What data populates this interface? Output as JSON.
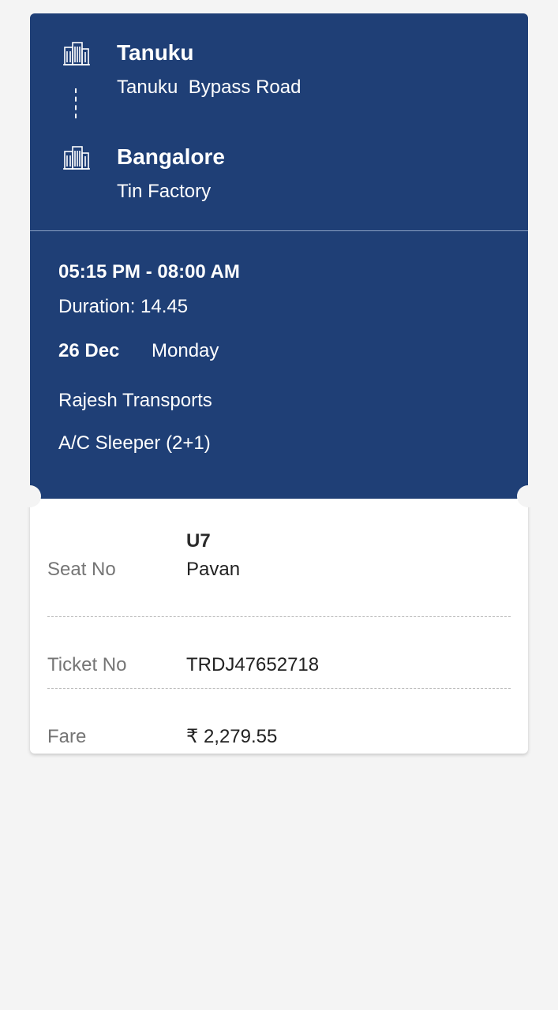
{
  "route": {
    "origin": {
      "city": "Tanuku",
      "point": "Tanuku  Bypass Road",
      "icon": "building-icon"
    },
    "destination": {
      "city": "Bangalore",
      "point": "Tin Factory",
      "icon": "building-icon"
    }
  },
  "journey": {
    "time_range": "05:15 PM - 08:00 AM",
    "duration": "Duration: 14.45",
    "date": "26 Dec",
    "day": "Monday",
    "operator": "Rajesh Transports",
    "bus_type": "A/C Sleeper (2+1)"
  },
  "details": {
    "seat_label": "Seat No",
    "seat_number": "U7",
    "passenger_name": "Pavan",
    "ticket_label": "Ticket No",
    "ticket_number": "TRDJ47652718",
    "fare_label": "Fare",
    "fare_value": "₹ 2,279.55"
  },
  "colors": {
    "header_bg": "#1f3f76",
    "page_bg": "#f4f4f4",
    "card_bg": "#ffffff",
    "label_text": "#757575"
  }
}
